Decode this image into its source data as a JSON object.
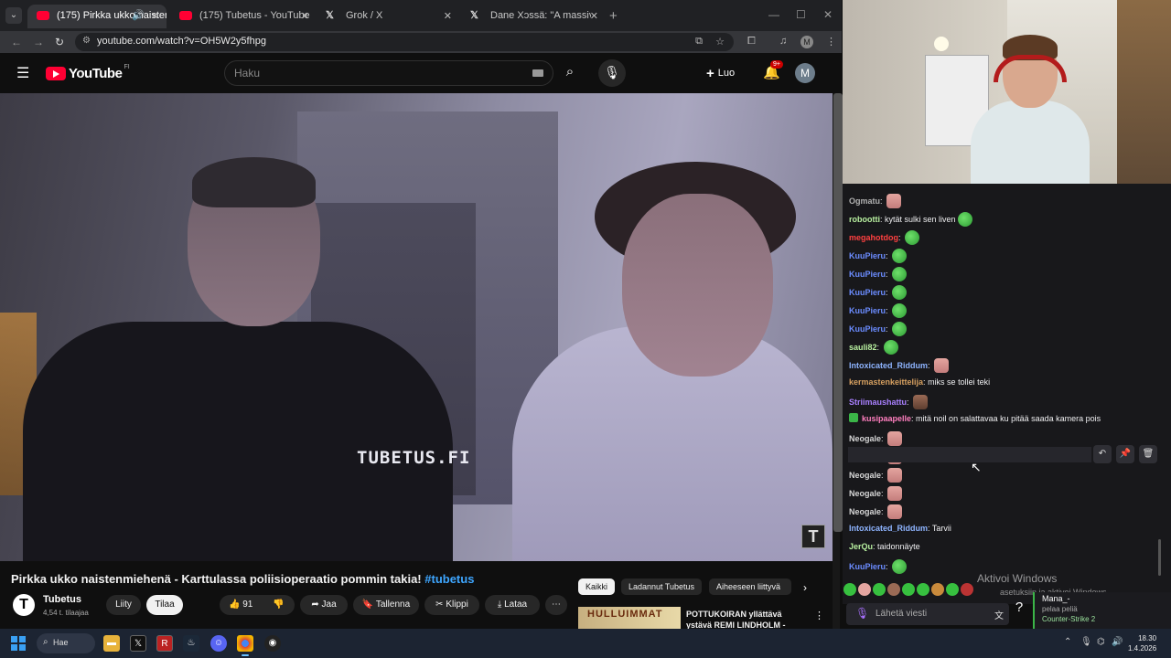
{
  "browser": {
    "tabs": [
      {
        "title": "(175) Pirkka ukko naistenmiehenä",
        "active": true,
        "sound": true
      },
      {
        "title": "(175) Tubetus - YouTube"
      },
      {
        "title": "Grok / X"
      },
      {
        "title": "Dane Xɔssä: \"A massive Swedish"
      }
    ],
    "url": "youtube.com/watch?v=OH5W2y5fhpg"
  },
  "youtube": {
    "logo": "YouTube",
    "country": "FI",
    "search_placeholder": "Haku",
    "create_label": "Luo",
    "notifications": "9+",
    "avatar": "M",
    "video": {
      "watermark": "TUBETUS.FI",
      "title": "Pirkka ukko naistenmiehenä - Karttulassa poliisioperaatio pommin takia!",
      "hashtag": "#tubetus",
      "channel": "Tubetus",
      "subscribers": "4,54 t. tilaajaa",
      "join": "Liity",
      "subscribe": "Tilaa",
      "likes": "91",
      "share": "Jaa",
      "save": "Tallenna",
      "clip": "Klippi",
      "download": "Lataa"
    },
    "chips": [
      "Kaikki",
      "Ladannut Tubetus",
      "Aiheeseen liittyvä"
    ],
    "related": {
      "thumb_text": "HULLUIMMAT",
      "title": "POTTUKOIRAN yllättävä ystävä REMI LINDHOLM - Kenu jatkaa..."
    }
  },
  "chat": {
    "messages": [
      {
        "user": "Ogmatu",
        "color": "#b0b0b0",
        "text": "",
        "emote": "pink"
      },
      {
        "user": "robootti",
        "color": "#b8f0a0",
        "text": "kytät sulki sen liven",
        "emote": "frog"
      },
      {
        "user": "megahotdog",
        "color": "#ff4040",
        "text": "",
        "emote": "frog"
      },
      {
        "user": "KuuPieru",
        "color": "#6b8cff",
        "text": "",
        "emote": "frog"
      },
      {
        "user": "KuuPieru",
        "color": "#6b8cff",
        "text": "",
        "emote": "frog"
      },
      {
        "user": "KuuPieru",
        "color": "#6b8cff",
        "text": "",
        "emote": "frog"
      },
      {
        "user": "KuuPieru",
        "color": "#6b8cff",
        "text": "",
        "emote": "frog"
      },
      {
        "user": "KuuPieru",
        "color": "#6b8cff",
        "text": "",
        "emote": "frog"
      },
      {
        "user": "sauli82",
        "color": "#b8f0a0",
        "text": "",
        "emote": "frog"
      },
      {
        "user": "Intoxicated_Riddum",
        "color": "#8eb4ff",
        "text": "",
        "emote": "pink"
      },
      {
        "user": "kermastenkeittelija",
        "color": "#d6a060",
        "text": "miks se tollei teki",
        "emote": ""
      },
      {
        "user": "Striimaushattu",
        "color": "#a980ff",
        "text": "",
        "emote": "brown"
      },
      {
        "user": "kusipaapelle",
        "color": "#ff7fbf",
        "text": "mitä noil on salattavaa ku pitää saada kamera pois",
        "emote": "",
        "badge": true
      },
      {
        "user": "Neogale",
        "color": "#d6d6d6",
        "text": "",
        "emote": "pink"
      },
      {
        "user": "Neogale",
        "color": "#d6d6d6",
        "text": "",
        "emote": "pink"
      },
      {
        "user": "Neogale",
        "color": "#d6d6d6",
        "text": "",
        "emote": "pink"
      },
      {
        "user": "Neogale",
        "color": "#d6d6d6",
        "text": "",
        "emote": "pink"
      },
      {
        "user": "Neogale",
        "color": "#d6d6d6",
        "text": "",
        "emote": "pink"
      },
      {
        "user": "Intoxicated_Riddum",
        "color": "#8eb4ff",
        "text": "Tarvii",
        "emote": ""
      },
      {
        "user": "JerQu",
        "color": "#b8f0a0",
        "text": "taidonnäyte",
        "emote": ""
      },
      {
        "user": "KuuPieru",
        "color": "#6b8cff",
        "text": "",
        "emote": "frog"
      }
    ],
    "input_placeholder": "Lähetä viesti",
    "presence": {
      "name": "Mana_-",
      "status": "pelaa peliä",
      "game": "Counter-Strike 2"
    }
  },
  "windows": {
    "activate_title": "Aktivoi Windows",
    "activate_sub": "asetuksiin ja aktivoi Windows.",
    "search_label": "Hae",
    "time": "18.30",
    "date": "1.4.2026"
  }
}
